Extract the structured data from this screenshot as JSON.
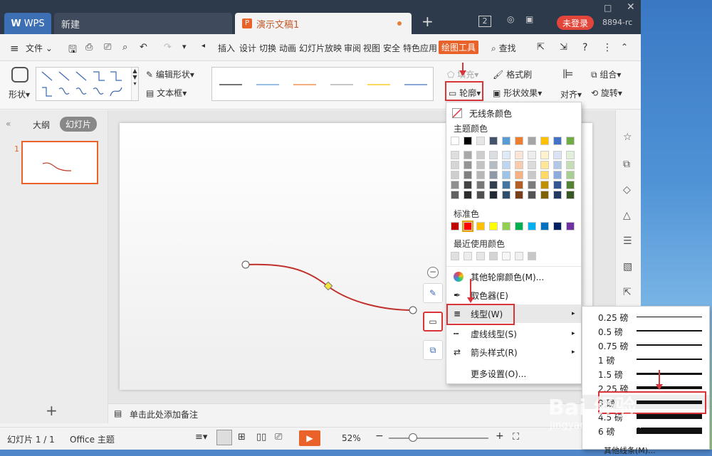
{
  "titlebar": {
    "wps_tab": "WPS",
    "new_tab": "新建",
    "doc_tab": "演示文稿1",
    "badge_count": "2",
    "login_button": "未登录",
    "user_id": "8894-rc"
  },
  "menubar": {
    "file": "文件",
    "items": [
      "插入",
      "设计",
      "切换",
      "动画",
      "幻灯片放映",
      "审阅",
      "视图",
      "安全",
      "特色应用"
    ],
    "active_tab": "绘图工具",
    "search": "查找"
  },
  "ribbon": {
    "shape": "形状",
    "edit_shape": "编辑形状",
    "textbox": "文本框",
    "fill": "填充",
    "outline": "轮廓",
    "format_painter": "格式刷",
    "shape_effect": "形状效果",
    "align": "对齐",
    "group": "组合",
    "rotate": "旋转"
  },
  "leftpanel": {
    "outline_tab": "大纲",
    "slides_tab": "幻灯片",
    "slide_number": "1"
  },
  "notes": {
    "placeholder": "单击此处添加备注"
  },
  "statusbar": {
    "slide_info": "幻灯片 1 / 1",
    "theme": "Office 主题",
    "zoom": "52%"
  },
  "outline_menu": {
    "no_line_color": "无线条颜色",
    "theme_colors": "主题颜色",
    "standard_colors": "标准色",
    "recent_colors": "最近使用颜色",
    "more_outline_colors": "其他轮廓颜色(M)...",
    "eyedropper": "取色器(E)",
    "line_type": "线型(W)",
    "dash_type": "虚线线型(S)",
    "arrow_style": "箭头样式(R)",
    "more_settings": "更多设置(O)...",
    "theme_top_row": [
      "#ffffff",
      "#000000",
      "#e7e6e6",
      "#44546a",
      "#5b9bd5",
      "#ed7d31",
      "#a5a5a5",
      "#ffc000",
      "#4472c4",
      "#70ad47"
    ],
    "standard_row": [
      "#c00000",
      "#ff0000",
      "#ffc000",
      "#ffff00",
      "#92d050",
      "#00b050",
      "#00b0f0",
      "#0070c0",
      "#002060",
      "#7030a0"
    ],
    "recent_row": [
      "#e0e0e0",
      "#ececec",
      "#e6e6e6",
      "#d5d5d5",
      "#f6f6f6",
      "#f0f0f0",
      "#c7c7c7"
    ]
  },
  "line_width_menu": {
    "items": [
      "0.25 磅",
      "0.5 磅",
      "0.75 磅",
      "1 磅",
      "1.5 磅",
      "2.25 磅",
      "3 磅",
      "4.5 磅",
      "6 磅"
    ],
    "more": "其他线条(M)..."
  },
  "watermark": {
    "brand": "Bai 经验",
    "url": "jingyan.baidu.com"
  }
}
